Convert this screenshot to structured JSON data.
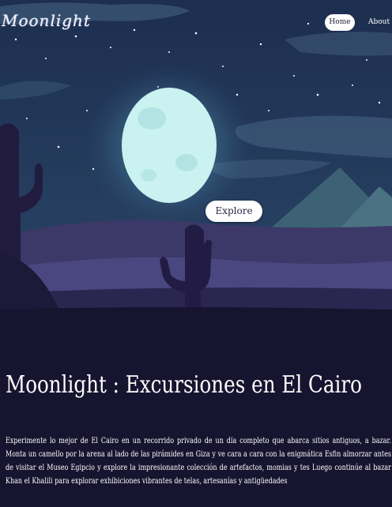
{
  "header": {
    "logo": "Moonlight",
    "nav": {
      "home": "Home",
      "about": "About"
    }
  },
  "hero": {
    "explore_label": "Explore"
  },
  "main": {
    "title": "Moonlight : Excursiones en El Cairo",
    "description": "Experimente lo mejor de El Cairo en un recorrido privado de un día completo que abarca sitios antiguos, a bazar. Monta un camello por la arena al lado de las pirámides en Giza y ve cara a cara con la enigmática Esfin almorzar antes de visitar el Museo Egipcio y explore la impresionante colección de artefactos, momias y tes Luego continúe al bazar Khan el Khalili para explorar exhibiciones vibrantes de telas, artesanías y antigüedades"
  },
  "colors": {
    "background": "#17142f",
    "sky": "#21355a",
    "moon": "#c9f2f0",
    "button": "#ffffff"
  }
}
